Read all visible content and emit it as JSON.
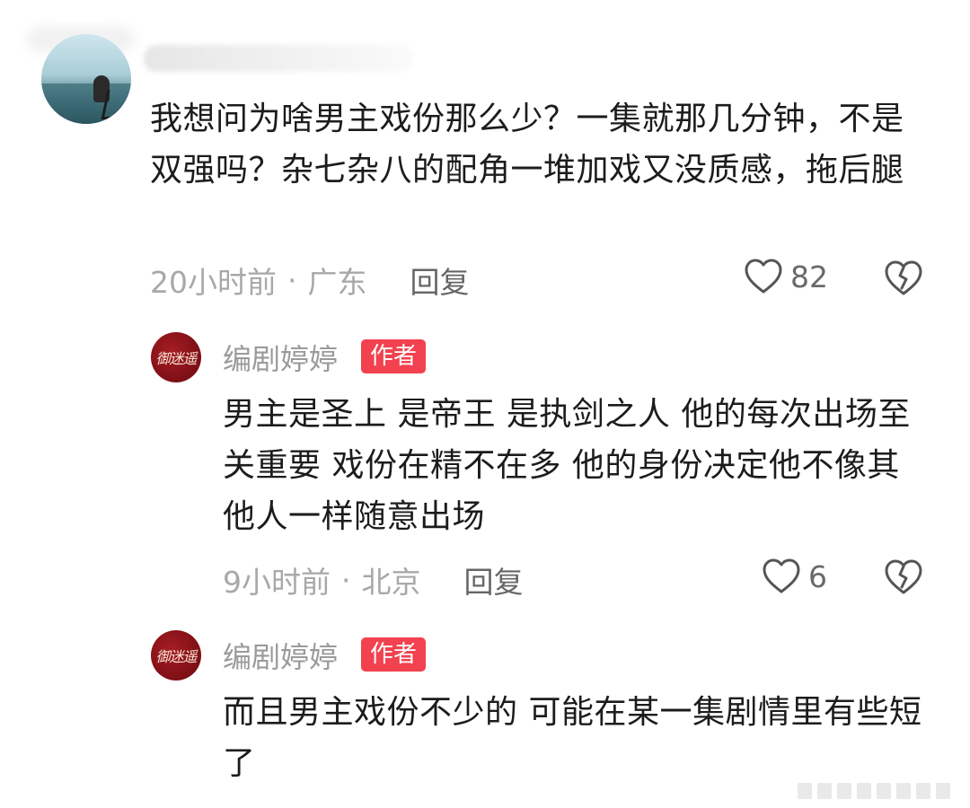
{
  "top_comment": {
    "text": "我想问为啥男主戏份那么少？一集就那几分钟，不是双强吗？杂七杂八的配角一堆加戏又没质感，拖后腿",
    "time": "20小时前",
    "location": "广东",
    "separator": "·",
    "reply_label": "回复",
    "like_count": "82"
  },
  "replies": [
    {
      "author": "编剧婷婷",
      "badge": "作者",
      "avatar_text": "御迷遥",
      "text": "男主是圣上 是帝王 是执剑之人 他的每次出场至关重要 戏份在精不在多 他的身份决定他不像其他人一样随意出场",
      "time": "9小时前",
      "location": "北京",
      "separator": "·",
      "reply_label": "回复",
      "like_count": "6"
    },
    {
      "author": "编剧婷婷",
      "badge": "作者",
      "avatar_text": "御迷遥",
      "text": "而且男主戏份不少的 可能在某一集剧情里有些短了"
    }
  ],
  "icons": {
    "like": "heart-outline-icon",
    "dislike": "broken-heart-icon"
  },
  "colors": {
    "badge": "#f2424f",
    "meta": "#a8a8a8",
    "text": "#1c1c1c",
    "avatar": "#7d0f15"
  }
}
